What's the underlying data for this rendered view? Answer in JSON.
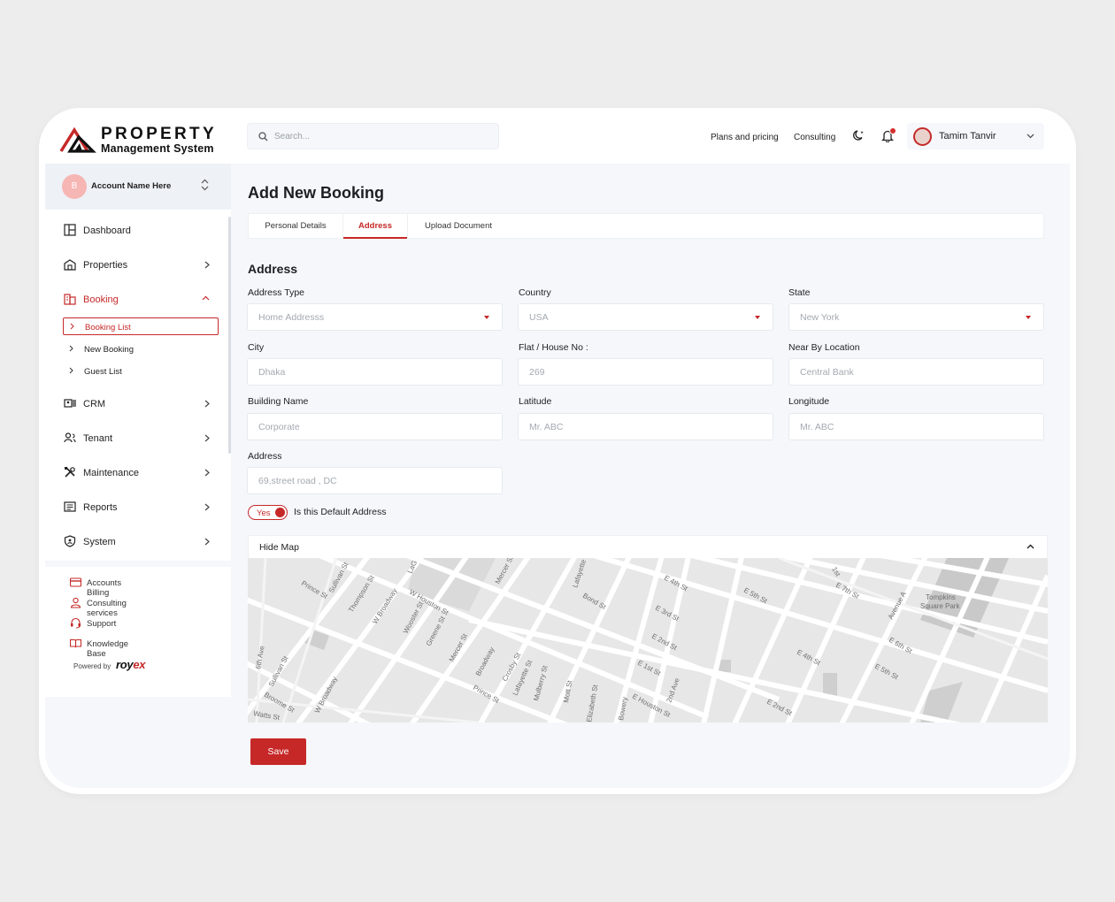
{
  "brand": {
    "line1": "PROPERTY",
    "line2": "Management System"
  },
  "search": {
    "placeholder": "Search..."
  },
  "header": {
    "plans": "Plans and pricing",
    "consulting": "Consulting",
    "user": "Tamim Tanvir",
    "notification_icon": "bell-icon",
    "theme_icon": "moon-icon"
  },
  "account": {
    "initial": "B",
    "name": "Account Name Here"
  },
  "sidebar": {
    "items": [
      {
        "label": "Dashboard",
        "icon": "dashboard-icon"
      },
      {
        "label": "Properties",
        "icon": "properties-icon"
      },
      {
        "label": "Booking",
        "icon": "booking-icon"
      },
      {
        "label": "CRM",
        "icon": "crm-icon"
      },
      {
        "label": "Tenant",
        "icon": "tenant-icon"
      },
      {
        "label": "Maintenance",
        "icon": "tools-icon"
      },
      {
        "label": "Reports",
        "icon": "reports-icon"
      },
      {
        "label": "System",
        "icon": "shield-icon"
      }
    ],
    "booking_sub": [
      {
        "label": "Booking List"
      },
      {
        "label": "New Booking"
      },
      {
        "label": "Guest List"
      }
    ],
    "footer": [
      {
        "label": "Accounts Billing",
        "icon": "card-icon"
      },
      {
        "label": "Consulting services",
        "icon": "user-icon"
      },
      {
        "label": "Support",
        "icon": "headset-icon"
      },
      {
        "label": "Knowledge Base",
        "icon": "book-icon"
      }
    ],
    "powered_by": "Powered by",
    "powered_brand_a": "roy",
    "powered_brand_b": "ex"
  },
  "page": {
    "title": "Add New Booking",
    "section": "Address"
  },
  "tabs": [
    {
      "label": "Personal Details"
    },
    {
      "label": "Address"
    },
    {
      "label": "Upload Document"
    }
  ],
  "form": {
    "address_type": {
      "label": "Address Type",
      "value": "Home Addresss"
    },
    "country": {
      "label": "Country",
      "value": "USA"
    },
    "state": {
      "label": "State",
      "value": "New York"
    },
    "city": {
      "label": "City",
      "value": "Dhaka"
    },
    "flat": {
      "label": "Flat / House No :",
      "value": "269"
    },
    "near": {
      "label": "Near By Location",
      "value": "Central Bank"
    },
    "building": {
      "label": "Building Name",
      "value": "Corporate"
    },
    "latitude": {
      "label": "Latitude",
      "value": "Mr. ABC"
    },
    "longitude": {
      "label": "Longitude",
      "value": "Mr. ABC"
    },
    "address": {
      "label": "Address",
      "value": "69,street road , DC"
    },
    "default_toggle": "Yes",
    "default_label": "Is this Default Address"
  },
  "map": {
    "toggle_label": "Hide Map",
    "labels": [
      "Prince St",
      "Sullivan St",
      "Thompson St",
      "W Broadway",
      "LaG",
      "W Houston St",
      "Wooster St",
      "Greene St",
      "Mercer St",
      "Broadway",
      "Crosby St",
      "Lafayette St",
      "Mulberry St",
      "Mott St",
      "Elizabeth St",
      "Bowery",
      "E Houston St",
      "2nd Ave",
      "E 1st St",
      "E 2nd St",
      "E 3rd St",
      "E 4th St",
      "E 5th St",
      "Lafayette",
      "Bond St",
      "E 7th St",
      "1st",
      "Avenue A",
      "Tompkins",
      "Square Park",
      "E 6th St",
      "6th Ave",
      "Watts St",
      "Broome St",
      "Sullivan St",
      "W Broadway",
      "Prince St",
      "Mercer St",
      "E 4th St",
      "E 5th St",
      "E 2nd St"
    ]
  },
  "actions": {
    "save": "Save"
  }
}
